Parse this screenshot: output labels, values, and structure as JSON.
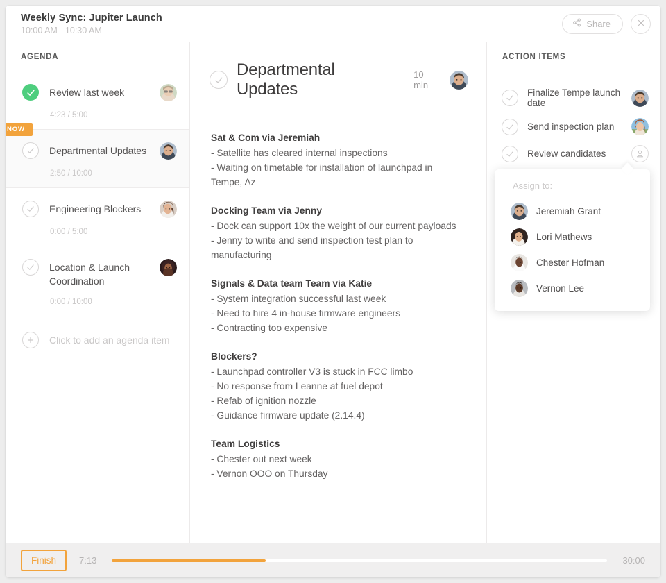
{
  "header": {
    "title": "Weekly Sync: Jupiter Launch",
    "time_range": "10:00 AM - 10:30 AM",
    "share_label": "Share"
  },
  "agenda": {
    "panel_title": "AGENDA",
    "now_badge": "NOW",
    "add_label": "Click to add an agenda item",
    "items": [
      {
        "label": "Review last week",
        "time": "4:23 / 5:00",
        "done": true,
        "active": false
      },
      {
        "label": "Departmental Updates",
        "time": "2:50 / 10:00",
        "done": false,
        "active": true
      },
      {
        "label": "Engineering Blockers",
        "time": "0:00 / 5:00",
        "done": false,
        "active": false
      },
      {
        "label": "Location & Launch Coordination",
        "time": "0:00 / 10:00",
        "done": false,
        "active": false
      }
    ]
  },
  "notes": {
    "title": "Departmental Updates",
    "duration": "10 min",
    "blocks": [
      {
        "heading": "Sat & Com via Jeremiah",
        "lines": [
          "- Satellite has cleared internal inspections",
          "- Waiting on timetable for installation of launchpad in Tempe, Az"
        ]
      },
      {
        "heading": "Docking Team via Jenny",
        "lines": [
          "- Dock can support 10x the weight of our current payloads",
          "- Jenny to write and send inspection test plan to manufacturing"
        ]
      },
      {
        "heading": "Signals & Data team Team via Katie",
        "lines": [
          "- System integration successful last week",
          "- Need to hire 4 in-house firmware engineers",
          "- Contracting too expensive"
        ]
      },
      {
        "heading": "Blockers?",
        "lines": [
          "- Launchpad controller V3 is stuck in FCC limbo",
          "- No response from Leanne at fuel depot",
          "- Refab of ignition nozzle",
          "- Guidance firmware update (2.14.4)"
        ]
      },
      {
        "heading": "Team Logistics",
        "lines": [
          "- Chester out next week",
          "- Vernon OOO on Thursday"
        ]
      }
    ]
  },
  "action_items": {
    "panel_title": "ACTION ITEMS",
    "items": [
      {
        "label": "Finalize Tempe launch date",
        "assigned": true
      },
      {
        "label": "Send inspection plan",
        "assigned": true
      },
      {
        "label": "Review candidates",
        "assigned": false
      }
    ],
    "assign_popover": {
      "title": "Assign to:",
      "people": [
        {
          "name": "Jeremiah Grant"
        },
        {
          "name": "Lori Mathews"
        },
        {
          "name": "Chester Hofman"
        },
        {
          "name": "Vernon Lee"
        }
      ]
    }
  },
  "footer": {
    "finish_label": "Finish",
    "elapsed": "7:13",
    "total": "30:00",
    "progress_percent": 31
  },
  "colors": {
    "accent_orange": "#f2a33c",
    "done_green": "#4ece7e",
    "page_background": "#ededed"
  }
}
